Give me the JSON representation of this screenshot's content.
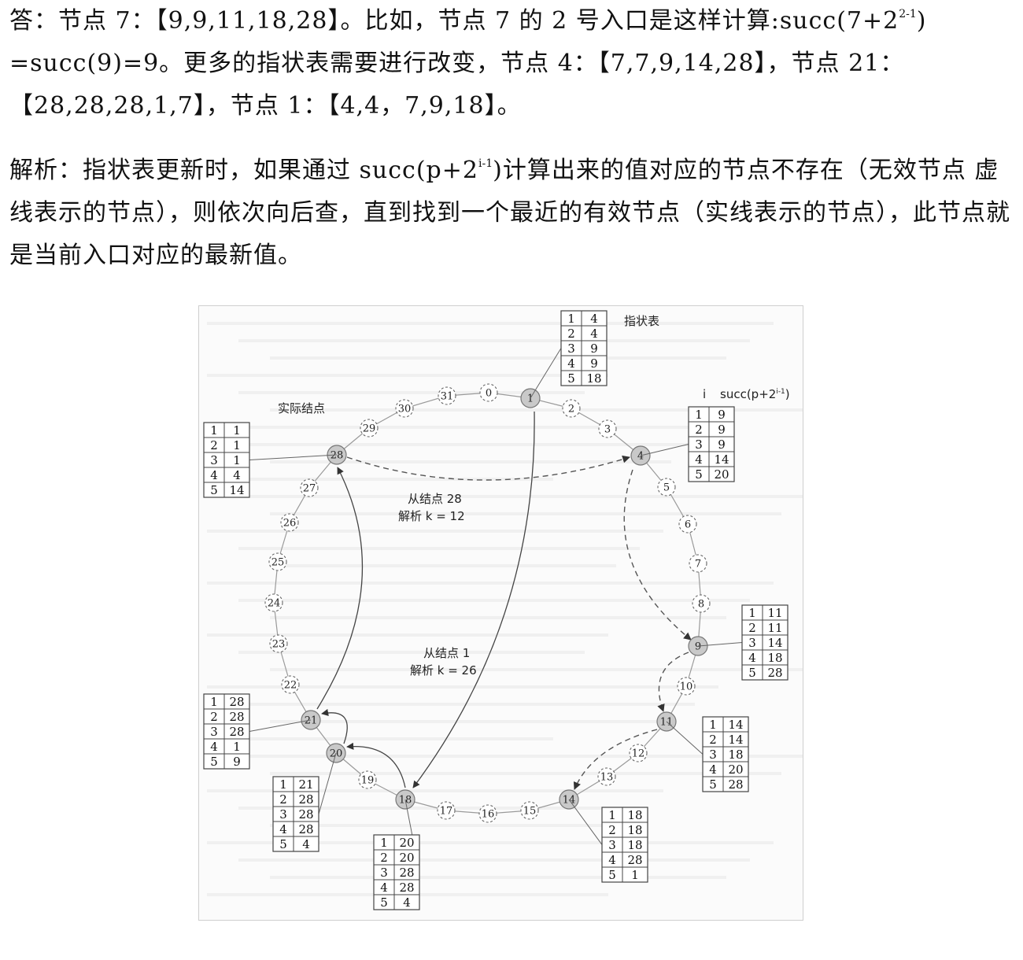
{
  "answer": {
    "line1": "答：节点 7：【9,9,11,18,28】。比如，节点 7 的 2 号入口是这样计算:succ(7+2",
    "line1_sup": "2-1",
    "line1_tail": ")",
    "line2": "=succ(9)=9。更多的指状表需要进行改变，节点 4：【7,7,9,14,28】，节点 21：",
    "line3": "【28,28,28,1,7】，节点 1：【4,4，7,9,18】。"
  },
  "analysis": {
    "part1": "解析：指状表更新时，如果通过 succ(p+2",
    "sup": "i-1",
    "part2": ")计算出来的值对应的节点不存在（无效节点 虚线表示的节点），则依次向后查，直到找到一个最近的有效节点（实线表示的节点），此节点就是当前入口对应的最新值。"
  },
  "figure": {
    "label_finger_table": "指状表",
    "label_actual_node": "实际结点",
    "header_i": "i",
    "header_succ": "succ(p+2",
    "header_succ_sup": "i-1",
    "header_succ_close": ")",
    "note_from_28_line1": "从结点 28",
    "note_from_28_line2": "解析 k = 12",
    "note_from_1_line1": "从结点 1",
    "note_from_1_line2": "解析 k = 26",
    "actual_nodes": [
      "1",
      "4",
      "9",
      "11",
      "14",
      "18",
      "20",
      "21",
      "28"
    ],
    "virtual_nodes": [
      "0",
      "2",
      "3",
      "5",
      "6",
      "7",
      "8",
      "10",
      "12",
      "13",
      "15",
      "16",
      "17",
      "19",
      "22",
      "23",
      "24",
      "25",
      "26",
      "27",
      "29",
      "30",
      "31"
    ],
    "tables": {
      "n1": {
        "index": [
          "1",
          "2",
          "3",
          "4",
          "5"
        ],
        "succ": [
          "4",
          "4",
          "9",
          "9",
          "18"
        ]
      },
      "n4": {
        "index": [
          "1",
          "2",
          "3",
          "4",
          "5"
        ],
        "succ": [
          "9",
          "9",
          "9",
          "14",
          "20"
        ]
      },
      "n9": {
        "index": [
          "1",
          "2",
          "3",
          "4",
          "5"
        ],
        "succ": [
          "11",
          "11",
          "14",
          "18",
          "28"
        ]
      },
      "n11": {
        "index": [
          "1",
          "2",
          "3",
          "4",
          "5"
        ],
        "succ": [
          "14",
          "14",
          "18",
          "20",
          "28"
        ]
      },
      "n14": {
        "index": [
          "1",
          "2",
          "3",
          "4",
          "5"
        ],
        "succ": [
          "18",
          "18",
          "18",
          "28",
          "1"
        ]
      },
      "n18": {
        "index": [
          "1",
          "2",
          "3",
          "4",
          "5"
        ],
        "succ": [
          "20",
          "20",
          "28",
          "28",
          "4"
        ]
      },
      "n20": {
        "index": [
          "1",
          "2",
          "3",
          "4",
          "5"
        ],
        "succ": [
          "21",
          "28",
          "28",
          "28",
          "4"
        ]
      },
      "n21": {
        "index": [
          "1",
          "2",
          "3",
          "4",
          "5"
        ],
        "succ": [
          "28",
          "28",
          "28",
          "1",
          "9"
        ]
      },
      "n28": {
        "index": [
          "1",
          "2",
          "3",
          "4",
          "5"
        ],
        "succ": [
          "1",
          "1",
          "1",
          "4",
          "14"
        ]
      }
    }
  }
}
